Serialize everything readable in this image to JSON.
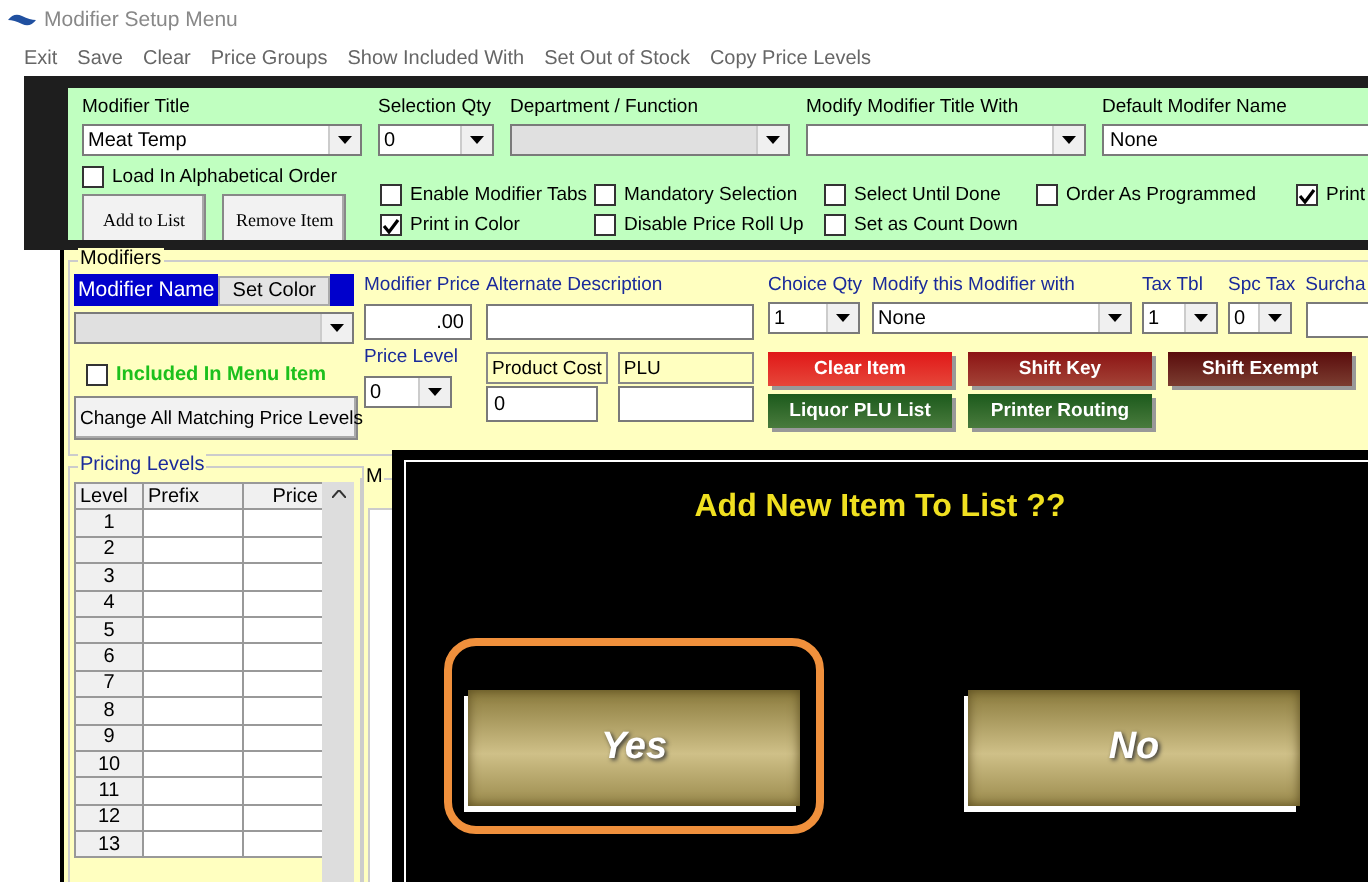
{
  "window": {
    "title": "Modifier Setup Menu"
  },
  "menu": [
    "Exit",
    "Save",
    "Clear",
    "Price Groups",
    "Show Included With",
    "Set Out of Stock",
    "Copy Price Levels"
  ],
  "header": {
    "fields": [
      {
        "label": "Modifier Title",
        "value": "Meat Temp",
        "kind": "select"
      },
      {
        "label": "Selection Qty",
        "value": "0",
        "kind": "select"
      },
      {
        "label": "Department / Function",
        "kind": "select",
        "disabled": true
      },
      {
        "label": "Modify Modifier Title With",
        "kind": "select"
      },
      {
        "label": "Default Modifer Name",
        "value": "None",
        "kind": "text"
      }
    ],
    "alphabetical": {
      "label": "Load In Alphabetical Order",
      "checked": false
    },
    "buttons": [
      "Add to List",
      "Remove Item"
    ],
    "option_columns": [
      [
        {
          "label": "Enable Modifier Tabs",
          "checked": false
        },
        {
          "label": "Print in Color",
          "checked": true
        }
      ],
      [
        {
          "label": "Mandatory Selection",
          "checked": false
        },
        {
          "label": "Disable Price Roll Up",
          "checked": false
        }
      ],
      [
        {
          "label": "Select Until Done",
          "checked": false
        },
        {
          "label": "Set as Count Down",
          "checked": false
        }
      ],
      [
        {
          "label": "Order As Programmed",
          "checked": false
        }
      ],
      [
        {
          "label": "Print",
          "checked": true
        }
      ]
    ]
  },
  "modifiers": {
    "title": "Modifiers",
    "name_label": "Modifier Name",
    "set_color": "Set Color",
    "included": {
      "label": "Included In Menu Item",
      "checked": false
    },
    "change_all": "Change All Matching Price Levels",
    "price": {
      "label": "Modifier Price",
      "value": ".00"
    },
    "price_level": {
      "label": "Price Level",
      "value": "0"
    },
    "alt_desc": {
      "label": "Alternate Description"
    },
    "product_cost": {
      "label": "Product Cost",
      "value": "0"
    },
    "plu": {
      "label": "PLU"
    },
    "choice_qty": {
      "label": "Choice Qty",
      "value": "1"
    },
    "modify_with": {
      "label": "Modify this Modifier with",
      "value": "None"
    },
    "tax_tbl": {
      "label": "Tax Tbl",
      "value": "1"
    },
    "spc_tax": {
      "label": "Spc Tax",
      "value": "0"
    },
    "surcharge": {
      "label": "Surcha"
    },
    "action_buttons": [
      [
        {
          "label": "Clear Item",
          "color": "#e01818"
        },
        {
          "label": "Shift Key",
          "color": "#8c1414"
        },
        {
          "label": "Shift Exempt",
          "color": "#5a0c0c"
        }
      ],
      [
        {
          "label": "Liquor PLU List",
          "color": "#1c5a1c"
        },
        {
          "label": "Printer Routing",
          "color": "#1c5a1c"
        }
      ]
    ]
  },
  "pricing_levels": {
    "title": "Pricing Levels",
    "columns": [
      "Level",
      "Prefix",
      "Price"
    ],
    "rows": [
      "1",
      "2",
      "3",
      "4",
      "5",
      "6",
      "7",
      "8",
      "9",
      "10",
      "11",
      "12",
      "13"
    ]
  },
  "side_group": {
    "title": "M"
  },
  "dialog": {
    "message": "Add New Item To List ??",
    "buttons": [
      {
        "label": "Yes",
        "selected": true
      },
      {
        "label": "No",
        "selected": false
      }
    ]
  }
}
